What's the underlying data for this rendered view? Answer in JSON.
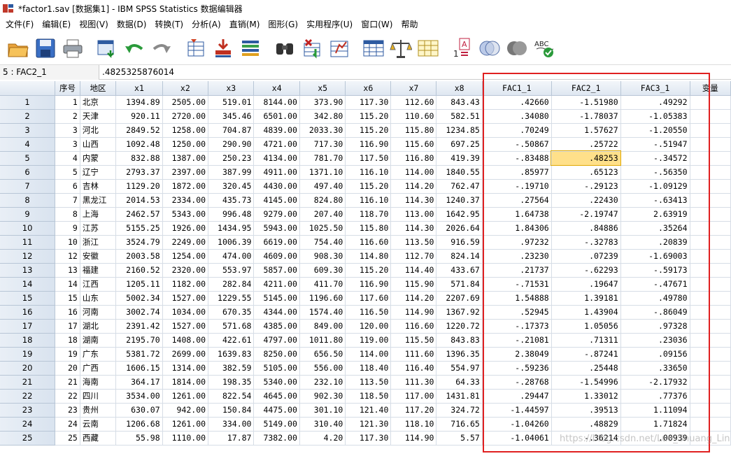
{
  "window": {
    "title": "*factor1.sav [数据集1] - IBM SPSS Statistics 数据编辑器"
  },
  "menu": [
    "文件(F)",
    "编辑(E)",
    "视图(V)",
    "数据(D)",
    "转换(T)",
    "分析(A)",
    "直销(M)",
    "图形(G)",
    "实用程序(U)",
    "窗口(W)",
    "帮助"
  ],
  "toolbar": {
    "icons": [
      "open-folder-icon",
      "save-icon",
      "print-icon",
      "dialog-recall-icon",
      "undo-icon",
      "redo-icon",
      "goto-case-icon",
      "goto-variable-icon",
      "variables-icon",
      "find-icon",
      "insert-cases-icon",
      "insert-variable-icon",
      "split-file-icon",
      "weight-cases-icon",
      "select-cases-icon",
      "value-labels-icon",
      "use-sets-icon",
      "show-all-variables-icon",
      "spell-check-icon"
    ],
    "spell_label": "ABC"
  },
  "cellref": {
    "name": "5 : FAC2_1",
    "value": ".4825325876014"
  },
  "columns": [
    "序号",
    "地区",
    "x1",
    "x2",
    "x3",
    "x4",
    "x5",
    "x6",
    "x7",
    "x8",
    "FAC1_1",
    "FAC2_1",
    "FAC3_1",
    "变量"
  ],
  "rows": [
    [
      "1",
      "1",
      "北京",
      "1394.89",
      "2505.00",
      "519.01",
      "8144.00",
      "373.90",
      "117.30",
      "112.60",
      "843.43",
      ".42660",
      "-1.51980",
      ".49292"
    ],
    [
      "2",
      "2",
      "天津",
      "920.11",
      "2720.00",
      "345.46",
      "6501.00",
      "342.80",
      "115.20",
      "110.60",
      "582.51",
      ".34080",
      "-1.78037",
      "-1.05383"
    ],
    [
      "3",
      "3",
      "河北",
      "2849.52",
      "1258.00",
      "704.87",
      "4839.00",
      "2033.30",
      "115.20",
      "115.80",
      "1234.85",
      ".70249",
      "1.57627",
      "-1.20550"
    ],
    [
      "4",
      "3",
      "山西",
      "1092.48",
      "1250.00",
      "290.90",
      "4721.00",
      "717.30",
      "116.90",
      "115.60",
      "697.25",
      "-.50867",
      ".25722",
      "-.51947"
    ],
    [
      "5",
      "4",
      "内蒙",
      "832.88",
      "1387.00",
      "250.23",
      "4134.00",
      "781.70",
      "117.50",
      "116.80",
      "419.39",
      "-.83488",
      ".48253",
      "-.34572"
    ],
    [
      "6",
      "5",
      "辽宁",
      "2793.37",
      "2397.00",
      "387.99",
      "4911.00",
      "1371.10",
      "116.10",
      "114.00",
      "1840.55",
      ".85977",
      ".65123",
      "-.56350"
    ],
    [
      "7",
      "6",
      "吉林",
      "1129.20",
      "1872.00",
      "320.45",
      "4430.00",
      "497.40",
      "115.20",
      "114.20",
      "762.47",
      "-.19710",
      "-.29123",
      "-1.09129"
    ],
    [
      "8",
      "7",
      "黑龙江",
      "2014.53",
      "2334.00",
      "435.73",
      "4145.00",
      "824.80",
      "116.10",
      "114.30",
      "1240.37",
      ".27564",
      ".22430",
      "-.63413"
    ],
    [
      "9",
      "8",
      "上海",
      "2462.57",
      "5343.00",
      "996.48",
      "9279.00",
      "207.40",
      "118.70",
      "113.00",
      "1642.95",
      "1.64738",
      "-2.19747",
      "2.63919"
    ],
    [
      "10",
      "9",
      "江苏",
      "5155.25",
      "1926.00",
      "1434.95",
      "5943.00",
      "1025.50",
      "115.80",
      "114.30",
      "2026.64",
      "1.84306",
      ".84886",
      ".35264"
    ],
    [
      "11",
      "10",
      "浙江",
      "3524.79",
      "2249.00",
      "1006.39",
      "6619.00",
      "754.40",
      "116.60",
      "113.50",
      "916.59",
      ".97232",
      "-.32783",
      ".20839"
    ],
    [
      "12",
      "12",
      "安徽",
      "2003.58",
      "1254.00",
      "474.00",
      "4609.00",
      "908.30",
      "114.80",
      "112.70",
      "824.14",
      ".23230",
      ".07239",
      "-1.69003"
    ],
    [
      "13",
      "13",
      "福建",
      "2160.52",
      "2320.00",
      "553.97",
      "5857.00",
      "609.30",
      "115.20",
      "114.40",
      "433.67",
      ".21737",
      "-.62293",
      "-.59173"
    ],
    [
      "14",
      "14",
      "江西",
      "1205.11",
      "1182.00",
      "282.84",
      "4211.00",
      "411.70",
      "116.90",
      "115.90",
      "571.84",
      "-.71531",
      ".19647",
      "-.47671"
    ],
    [
      "15",
      "15",
      "山东",
      "5002.34",
      "1527.00",
      "1229.55",
      "5145.00",
      "1196.60",
      "117.60",
      "114.20",
      "2207.69",
      "1.54888",
      "1.39181",
      ".49780"
    ],
    [
      "16",
      "16",
      "河南",
      "3002.74",
      "1034.00",
      "670.35",
      "4344.00",
      "1574.40",
      "116.50",
      "114.90",
      "1367.92",
      ".52945",
      "1.43904",
      "-.86049"
    ],
    [
      "17",
      "17",
      "湖北",
      "2391.42",
      "1527.00",
      "571.68",
      "4385.00",
      "849.00",
      "120.00",
      "116.60",
      "1220.72",
      "-.17373",
      "1.05056",
      ".97328"
    ],
    [
      "18",
      "18",
      "湖南",
      "2195.70",
      "1408.00",
      "422.61",
      "4797.00",
      "1011.80",
      "119.00",
      "115.50",
      "843.83",
      "-.21081",
      ".71311",
      ".23036"
    ],
    [
      "19",
      "19",
      "广东",
      "5381.72",
      "2699.00",
      "1639.83",
      "8250.00",
      "656.50",
      "114.00",
      "111.60",
      "1396.35",
      "2.38049",
      "-.87241",
      ".09156"
    ],
    [
      "20",
      "20",
      "广西",
      "1606.15",
      "1314.00",
      "382.59",
      "5105.00",
      "556.00",
      "118.40",
      "116.40",
      "554.97",
      "-.59236",
      ".25448",
      ".33650"
    ],
    [
      "21",
      "21",
      "海南",
      "364.17",
      "1814.00",
      "198.35",
      "5340.00",
      "232.10",
      "113.50",
      "111.30",
      "64.33",
      "-.28768",
      "-1.54996",
      "-2.17932"
    ],
    [
      "22",
      "22",
      "四川",
      "3534.00",
      "1261.00",
      "822.54",
      "4645.00",
      "902.30",
      "118.50",
      "117.00",
      "1431.81",
      ".29447",
      "1.33012",
      ".77376"
    ],
    [
      "23",
      "23",
      "贵州",
      "630.07",
      "942.00",
      "150.84",
      "4475.00",
      "301.10",
      "121.40",
      "117.20",
      "324.72",
      "-1.44597",
      ".39513",
      "1.11094"
    ],
    [
      "24",
      "24",
      "云南",
      "1206.68",
      "1261.00",
      "334.00",
      "5149.00",
      "310.40",
      "121.30",
      "118.10",
      "716.65",
      "-1.04260",
      ".48829",
      "1.71824"
    ],
    [
      "25",
      "25",
      "西藏",
      "55.98",
      "1110.00",
      "17.87",
      "7382.00",
      "4.20",
      "117.30",
      "114.90",
      "5.57",
      "-1.04061",
      "-.36214",
      ".00939"
    ]
  ],
  "selected": {
    "row": 5,
    "column": "FAC2_1"
  },
  "watermark": "https://blog.csdn.net/Luo_Shuang_Lin",
  "colors": {
    "annotation_box": "#e02020",
    "selected_cell": "#ffe08a"
  }
}
